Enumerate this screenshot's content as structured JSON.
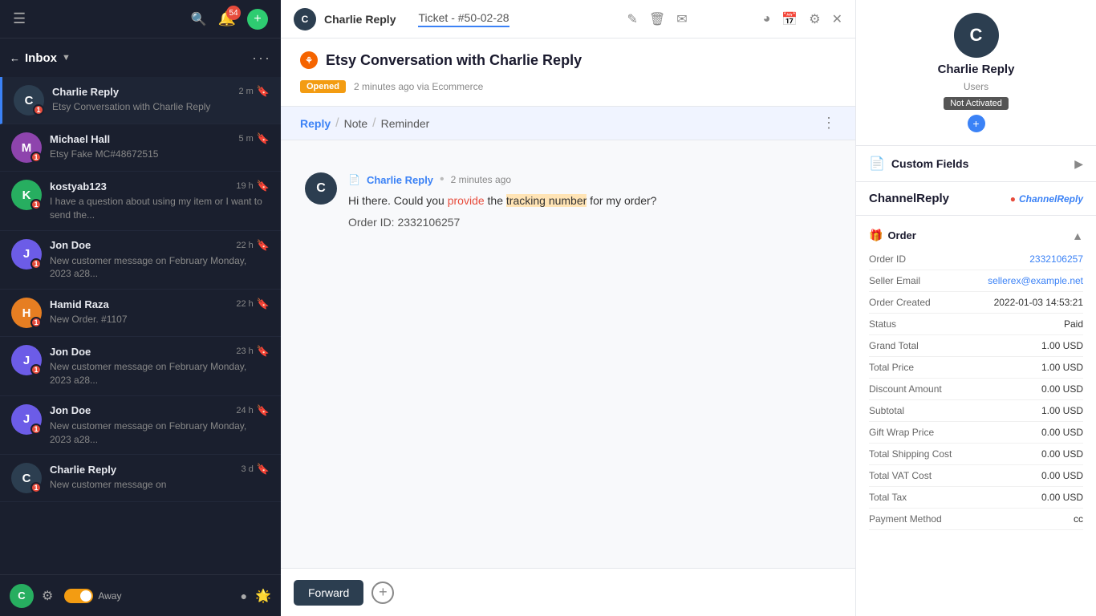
{
  "app": {
    "title": "Charlie Reply"
  },
  "sidebar": {
    "inbox_label": "Inbox",
    "nav_dots": "···",
    "conversations": [
      {
        "id": "conv-1",
        "name": "Charlie Reply",
        "avatar_letter": "C",
        "avatar_class": "av-c",
        "time": "2 m",
        "preview": "Etsy Conversation with Charlie Reply",
        "unread": "1",
        "active": true
      },
      {
        "id": "conv-2",
        "name": "Michael Hall",
        "avatar_letter": "M",
        "avatar_class": "av-m",
        "time": "5 m",
        "preview": "Etsy Fake MC#48672515",
        "unread": "1",
        "active": false
      },
      {
        "id": "conv-3",
        "name": "kostyab123",
        "avatar_letter": "K",
        "avatar_class": "av-k",
        "time": "19 h",
        "preview": "I have a question about using my item or I want to send the...",
        "unread": "1",
        "active": false
      },
      {
        "id": "conv-4",
        "name": "Jon Doe",
        "avatar_letter": "J",
        "avatar_class": "av-j",
        "time": "22 h",
        "preview": "New customer message on February Monday, 2023 a28...",
        "unread": "1",
        "active": false
      },
      {
        "id": "conv-5",
        "name": "Hamid Raza",
        "avatar_letter": "H",
        "avatar_class": "av-h",
        "time": "22 h",
        "preview": "New Order. #1107",
        "unread": "1",
        "active": false
      },
      {
        "id": "conv-6",
        "name": "Jon Doe",
        "avatar_letter": "J",
        "avatar_class": "av-j",
        "time": "23 h",
        "preview": "New customer message on February Monday, 2023 a28...",
        "unread": "1",
        "active": false
      },
      {
        "id": "conv-7",
        "name": "Jon Doe",
        "avatar_letter": "J",
        "avatar_class": "av-j",
        "time": "24 h",
        "preview": "New customer message on February Monday, 2023 a28...",
        "unread": "1",
        "active": false
      },
      {
        "id": "conv-8",
        "name": "Charlie Reply",
        "avatar_letter": "C",
        "avatar_class": "av-c",
        "time": "3 d",
        "preview": "New customer message on",
        "unread": "1",
        "active": false
      }
    ],
    "footer": {
      "avatar_letter": "C",
      "away_label": "Away"
    }
  },
  "header": {
    "avatar_letter": "C",
    "name": "Charlie Reply",
    "ticket": "Ticket - #50-02-28",
    "tab_label": "Ticket - #50-02-28"
  },
  "conversation": {
    "title": "Etsy Conversation with Charlie Reply",
    "status": "Opened",
    "time_meta": "2 minutes ago via Ecommerce",
    "reply_tab": "Reply",
    "note_tab": "Note",
    "reminder_tab": "Reminder",
    "message": {
      "sender": "Charlie Reply",
      "time": "2 minutes ago",
      "text_part1": "Hi there. Could you ",
      "text_highlight": "provide",
      "text_part2": " the ",
      "text_tracking": "tracking number",
      "text_part3": " for my order?",
      "order_label": "Order ID: 2332106257"
    }
  },
  "bottom_bar": {
    "forward_label": "Forward"
  },
  "right_panel": {
    "avatar_letter": "C",
    "name": "Charlie Reply",
    "role": "Users",
    "status": "Not Activated",
    "custom_fields_label": "Custom Fields",
    "channel_reply_label": "ChannelReply",
    "channel_reply_logo": "ChannelReply",
    "order_section": {
      "title": "Order",
      "fields": [
        {
          "label": "Order ID",
          "value": "2332106257",
          "is_link": true
        },
        {
          "label": "Seller Email",
          "value": "sellerex@example.net",
          "is_link": true
        },
        {
          "label": "Order Created",
          "value": "2022-01-03 14:53:21",
          "is_link": false
        },
        {
          "label": "Status",
          "value": "Paid",
          "is_link": false
        },
        {
          "label": "Grand Total",
          "value": "1.00 USD",
          "is_link": false
        },
        {
          "label": "Total Price",
          "value": "1.00 USD",
          "is_link": false
        },
        {
          "label": "Discount Amount",
          "value": "0.00 USD",
          "is_link": false
        },
        {
          "label": "Subtotal",
          "value": "1.00 USD",
          "is_link": false
        },
        {
          "label": "Gift Wrap Price",
          "value": "0.00 USD",
          "is_link": false
        },
        {
          "label": "Total Shipping Cost",
          "value": "0.00 USD",
          "is_link": false
        },
        {
          "label": "Total VAT Cost",
          "value": "0.00 USD",
          "is_link": false
        },
        {
          "label": "Total Tax",
          "value": "0.00 USD",
          "is_link": false
        },
        {
          "label": "Payment Method",
          "value": "cc",
          "is_link": false
        }
      ]
    }
  }
}
